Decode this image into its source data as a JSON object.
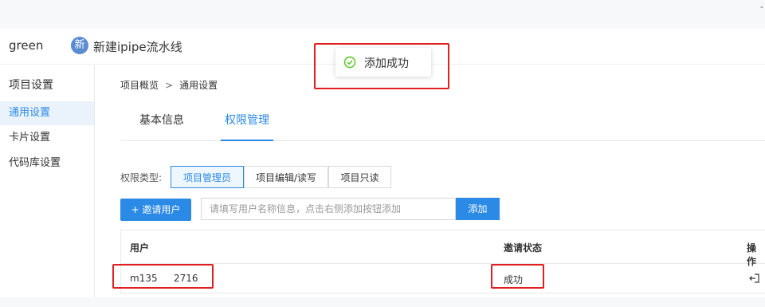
{
  "header": {
    "username": "green",
    "project_avatar": "新",
    "project_name": "新建ipipe流水线",
    "corner_mark": "-"
  },
  "sidebar": {
    "title": "项目设置",
    "items": [
      {
        "label": "通用设置",
        "active": true
      },
      {
        "label": "卡片设置",
        "active": false
      },
      {
        "label": "代码库设置",
        "active": false
      }
    ]
  },
  "breadcrumb": {
    "items": [
      "项目概览",
      "通用设置"
    ],
    "separator": ">"
  },
  "tabs": [
    {
      "label": "基本信息",
      "active": false
    },
    {
      "label": "权限管理",
      "active": true
    }
  ],
  "permission": {
    "label": "权限类型:",
    "options": [
      {
        "label": "项目管理员",
        "active": true
      },
      {
        "label": "项目编辑/读写",
        "active": false
      },
      {
        "label": "项目只读",
        "active": false
      }
    ]
  },
  "invite": {
    "button_label": "+ 邀请用户",
    "input_value": "",
    "input_placeholder": "请填写用户名称信息，点击右侧添加按钮添加",
    "add_label": "添加"
  },
  "table": {
    "columns": [
      "用户",
      "邀请状态",
      "操作"
    ],
    "rows": [
      {
        "user_prefix": "m135",
        "user_suffix": "2716",
        "status": "成功",
        "action_icon": "exit-icon"
      }
    ]
  },
  "toast": {
    "text": "添加成功",
    "icon": "check-circle-icon"
  },
  "colors": {
    "accent": "#2b8ae6",
    "highlight": "#e02020",
    "toast_icon": "#52c41a",
    "avatar": "#5b8bd0"
  }
}
